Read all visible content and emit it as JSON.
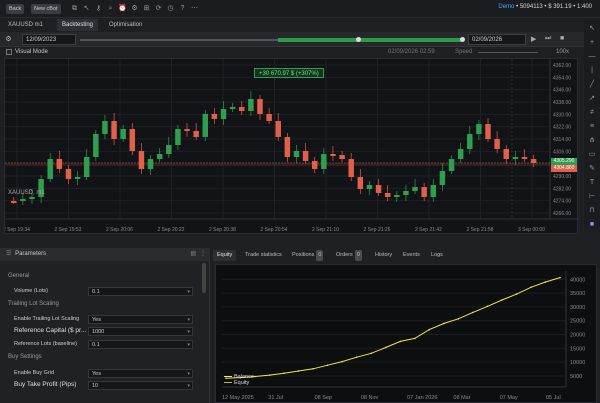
{
  "topbar": {
    "back_label": "Back",
    "new_cbot_label": "New cBot",
    "account_label": "Demo",
    "account_info": "• 5094113 • $ 391.19 • 1:400"
  },
  "tabs": [
    {
      "label": "XAUUSD m1"
    },
    {
      "label": "Backtesting"
    },
    {
      "label": "Optimisation"
    }
  ],
  "dates": {
    "start": "12/09/2023",
    "end": "02/09/2026"
  },
  "speed_label": "Speed",
  "progress_date": "02/09/2026 02:59",
  "visual_mode_label": "Visual Mode",
  "zoom_label": "100x",
  "chart": {
    "pnl_label": "+30 670.97 $ (+307%)",
    "symbol_label": "XAUUSD, m1",
    "current_price_a": "4305.290",
    "current_price_b": "4304.860",
    "y_ticks": [
      "4362.00",
      "4354.00",
      "4346.00",
      "4338.00",
      "4330.00",
      "4322.00",
      "4314.00",
      "4306.00",
      "4298.00",
      "4290.00",
      "4282.00",
      "4274.00",
      "4266.00"
    ],
    "x_ticks": [
      "2 Sep 19:34",
      "2 Sep 19:53",
      "2 Sep 20:06",
      "2 Sep 20:22",
      "2 Sep 20:38",
      "2 Sep 20:54",
      "2 Sep 21:10",
      "2 Sep 21:26",
      "2 Sep 21:42",
      "2 Sep 21:58",
      "3 Sep 00:00"
    ],
    "colors": {
      "up": "#2f9e4e",
      "down": "#e0604a",
      "bg": "#121316"
    }
  },
  "params": {
    "title": "Parameters",
    "sections": [
      {
        "label": "General",
        "rows": [
          {
            "name": "Volume (Lots)",
            "value": "0.1"
          }
        ]
      },
      {
        "label": "Trailing Lot Scaling",
        "rows": [
          {
            "name": "Enable Trailing Lot Scaling",
            "value": "Yes"
          },
          {
            "name": "Reference Capital ($ pr...",
            "value": "1000",
            "big": true
          },
          {
            "name": "Reference Lots (baseline)",
            "value": "0.1"
          }
        ]
      },
      {
        "label": "Buy Settings",
        "rows": [
          {
            "name": "Enable Buy Grid",
            "value": "Yes"
          },
          {
            "name": "Buy Take Profit (Pips)",
            "value": "10",
            "big": true
          }
        ]
      }
    ]
  },
  "bottom_tabs": [
    {
      "label": "Equity"
    },
    {
      "label": "Trade statistics"
    },
    {
      "label": "Positions",
      "count": "0"
    },
    {
      "label": "Orders",
      "count": "0"
    },
    {
      "label": "History"
    },
    {
      "label": "Events"
    },
    {
      "label": "Logs"
    }
  ],
  "equity_chart": {
    "type": "line",
    "x_ticks": [
      "12 May 2025",
      "31 Jul",
      "08 Sep",
      "08 Nov",
      "07 Jan 2026",
      "08 Mar",
      "07 May",
      "05 Jul"
    ],
    "y_ticks": [
      "5000",
      "10000",
      "15000",
      "20000",
      "25000",
      "30000",
      "35000",
      "40000"
    ],
    "ylim": [
      1000,
      43000
    ],
    "legend": [
      "Balance",
      "Equity"
    ],
    "series_color": "#f2e64a",
    "values": [
      4200,
      4400,
      4800,
      5300,
      6000,
      6800,
      7600,
      8900,
      10200,
      11800,
      13200,
      15300,
      17500,
      18600,
      21800,
      24000,
      25700,
      28000,
      30200,
      32500,
      34600,
      37100,
      39000,
      40600
    ]
  }
}
